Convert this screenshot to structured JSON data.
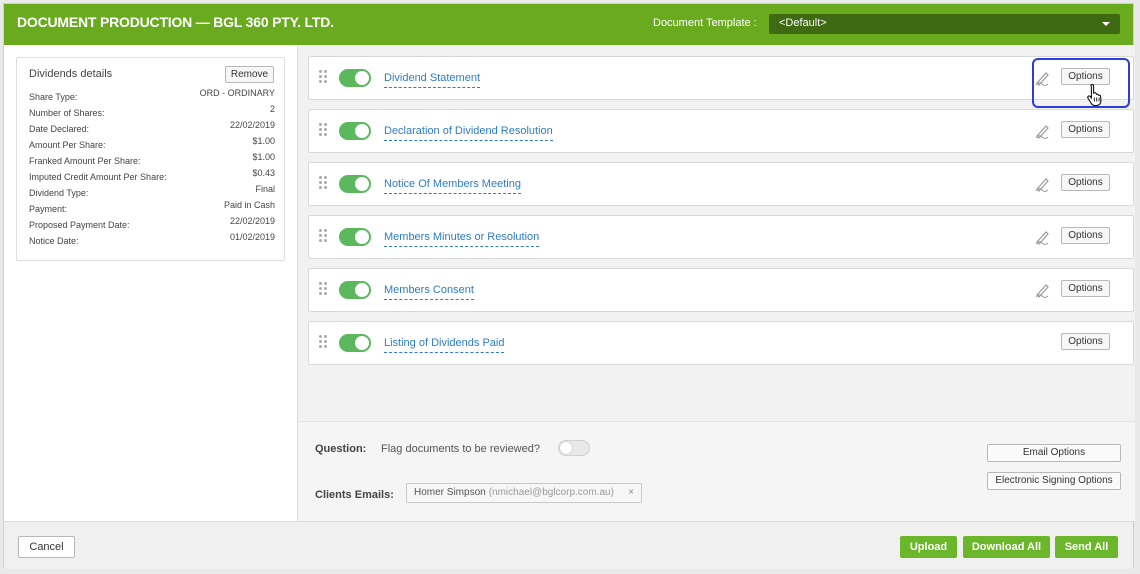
{
  "header": {
    "title": "DOCUMENT PRODUCTION — BGL 360 PTY. LTD.",
    "template_label": "Document Template :",
    "template_value": "<Default>"
  },
  "details": {
    "title": "Dividends details",
    "remove_label": "Remove",
    "rows": [
      {
        "key": "Share Type:",
        "value": "ORD - ORDINARY"
      },
      {
        "key": "Number of Shares:",
        "value": "2"
      },
      {
        "key": "Date Declared:",
        "value": "22/02/2019"
      },
      {
        "key": "Amount Per Share:",
        "value": "$1.00"
      },
      {
        "key": "Franked Amount Per Share:",
        "value": "$1.00"
      },
      {
        "key": "Imputed Credit Amount Per Share:",
        "value": "$0.43"
      },
      {
        "key": "Dividend Type:",
        "value": "Final"
      },
      {
        "key": "Payment:",
        "value": "Paid in Cash"
      },
      {
        "key": "Proposed Payment Date:",
        "value": "22/02/2019"
      },
      {
        "key": "Notice Date:",
        "value": "01/02/2019"
      }
    ]
  },
  "documents": [
    {
      "name": "Dividend Statement",
      "enabled": true,
      "sign_icon": true,
      "options_label": "Options"
    },
    {
      "name": "Declaration of Dividend Resolution",
      "enabled": true,
      "sign_icon": true,
      "options_label": "Options"
    },
    {
      "name": "Notice Of Members Meeting",
      "enabled": true,
      "sign_icon": true,
      "options_label": "Options"
    },
    {
      "name": "Members Minutes or Resolution",
      "enabled": true,
      "sign_icon": true,
      "options_label": "Options"
    },
    {
      "name": "Members Consent",
      "enabled": true,
      "sign_icon": true,
      "options_label": "Options"
    },
    {
      "name": "Listing of Dividends Paid",
      "enabled": true,
      "sign_icon": false,
      "options_label": "Options"
    }
  ],
  "question": {
    "label": "Question:",
    "text": "Flag documents to be reviewed?",
    "enabled": false
  },
  "clients": {
    "label": "Clients Emails:",
    "chips": [
      {
        "name": "Homer Simpson",
        "email": "(nmichael@bglcorp.com.au)",
        "remove": "×"
      }
    ]
  },
  "side_buttons": {
    "email_options": "Email Options",
    "esign_options": "Electronic Signing Options"
  },
  "footer": {
    "cancel": "Cancel",
    "upload": "Upload",
    "download_all": "Download All",
    "send_all": "Send All"
  },
  "colors": {
    "brand_green": "#6aaa1f",
    "toggle_on": "#5cb85c",
    "link_blue": "#2f7dc0",
    "highlight": "#2b3fd8"
  }
}
